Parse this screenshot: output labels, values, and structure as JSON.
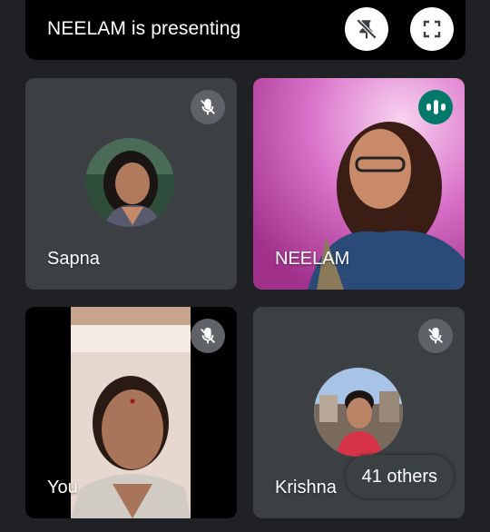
{
  "banner": {
    "text": "NEELAM is presenting",
    "unpin_icon": "unpin-icon",
    "fullscreen_icon": "fullscreen-icon"
  },
  "tiles": [
    {
      "name": "Sapna",
      "muted": true
    },
    {
      "name": "NEELAM",
      "muted": false,
      "speaking": true
    },
    {
      "name": "You",
      "muted": true
    },
    {
      "name": "Krishna",
      "muted": true
    }
  ],
  "others": {
    "label": "41 others"
  },
  "colors": {
    "background": "#202124",
    "tile": "#3c4043",
    "mute_badge": "#5f6368",
    "speaking_badge": "#00796b"
  }
}
